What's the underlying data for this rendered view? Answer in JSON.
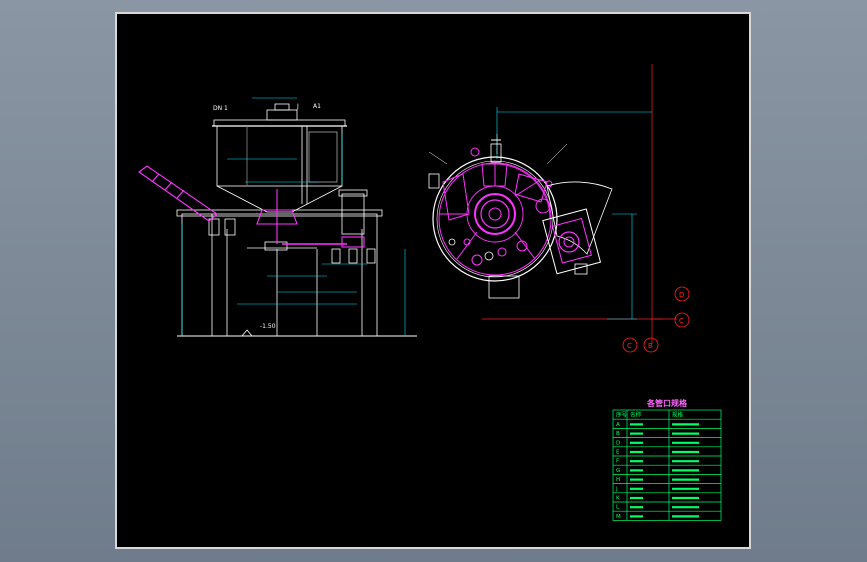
{
  "colors": {
    "background": "#7a8796",
    "sheet": "#000000",
    "frame": "#d8d8d8",
    "outline": "#ffffff",
    "dimension": "#00e5ff",
    "equipment": "#ff33ff",
    "centerline": "#ff2020",
    "table": "#00ff66",
    "label": "#ffff00"
  },
  "front_view": {
    "labels": {
      "dn": "DN 1",
      "j": "J",
      "a1": "A1",
      "elevation": "-1.50"
    }
  },
  "top_view": {
    "balloons": [
      "D",
      "C",
      "C",
      "B"
    ]
  },
  "nozzle_table": {
    "title": "各管口规格",
    "header": [
      "序号",
      "名称",
      "规格"
    ],
    "rows": [
      [
        "A",
        "",
        ""
      ],
      [
        "B",
        "",
        ""
      ],
      [
        "D",
        "",
        ""
      ],
      [
        "E",
        "",
        ""
      ],
      [
        "F",
        "",
        ""
      ],
      [
        "G",
        "",
        ""
      ],
      [
        "H",
        "",
        ""
      ],
      [
        "J",
        "",
        ""
      ],
      [
        "K",
        "",
        ""
      ],
      [
        "L",
        "",
        ""
      ],
      [
        "M",
        "",
        ""
      ]
    ]
  }
}
